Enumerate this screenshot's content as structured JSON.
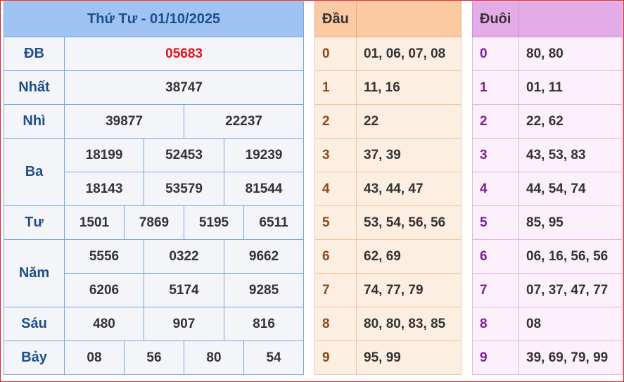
{
  "results": {
    "title": "Thứ Tư - 01/10/2025",
    "rows": {
      "db": {
        "label": "ĐB",
        "values": [
          "05683"
        ]
      },
      "nhat": {
        "label": "Nhất",
        "values": [
          "38747"
        ]
      },
      "nhi": {
        "label": "Nhì",
        "values": [
          "39877",
          "22237"
        ]
      },
      "ba": {
        "label": "Ba",
        "values": [
          "18199",
          "52453",
          "19239",
          "18143",
          "53579",
          "81544"
        ]
      },
      "tu": {
        "label": "Tư",
        "values": [
          "1501",
          "7869",
          "5195",
          "6511"
        ]
      },
      "nam": {
        "label": "Năm",
        "values": [
          "5556",
          "0322",
          "9662",
          "6206",
          "5174",
          "9285"
        ]
      },
      "sau": {
        "label": "Sáu",
        "values": [
          "480",
          "907",
          "816"
        ]
      },
      "bay": {
        "label": "Bảy",
        "values": [
          "08",
          "56",
          "80",
          "54"
        ]
      }
    },
    "special_color": "#e0141e"
  },
  "dau": {
    "header": "Đầu",
    "rows": [
      {
        "key": "0",
        "values": "01, 06, 07, 08"
      },
      {
        "key": "1",
        "values": "11, 16"
      },
      {
        "key": "2",
        "values": "22"
      },
      {
        "key": "3",
        "values": "37, 39"
      },
      {
        "key": "4",
        "values": "43, 44, 47"
      },
      {
        "key": "5",
        "values": "53, 54, 56, 56"
      },
      {
        "key": "6",
        "values": "62, 69"
      },
      {
        "key": "7",
        "values": "74, 77, 79"
      },
      {
        "key": "8",
        "values": "80, 80, 83, 85"
      },
      {
        "key": "9",
        "values": "95, 99"
      }
    ]
  },
  "duoi": {
    "header": "Đuôi",
    "rows": [
      {
        "key": "0",
        "values": "80, 80"
      },
      {
        "key": "1",
        "values": "01, 11"
      },
      {
        "key": "2",
        "values": "22, 62"
      },
      {
        "key": "3",
        "values": "43, 53, 83"
      },
      {
        "key": "4",
        "values": "44, 54, 74"
      },
      {
        "key": "5",
        "values": "85, 95"
      },
      {
        "key": "6",
        "values": "06, 16, 56, 56"
      },
      {
        "key": "7",
        "values": "07, 37, 47, 77"
      },
      {
        "key": "8",
        "values": "08"
      },
      {
        "key": "9",
        "values": "39, 69, 79, 99"
      }
    ]
  }
}
